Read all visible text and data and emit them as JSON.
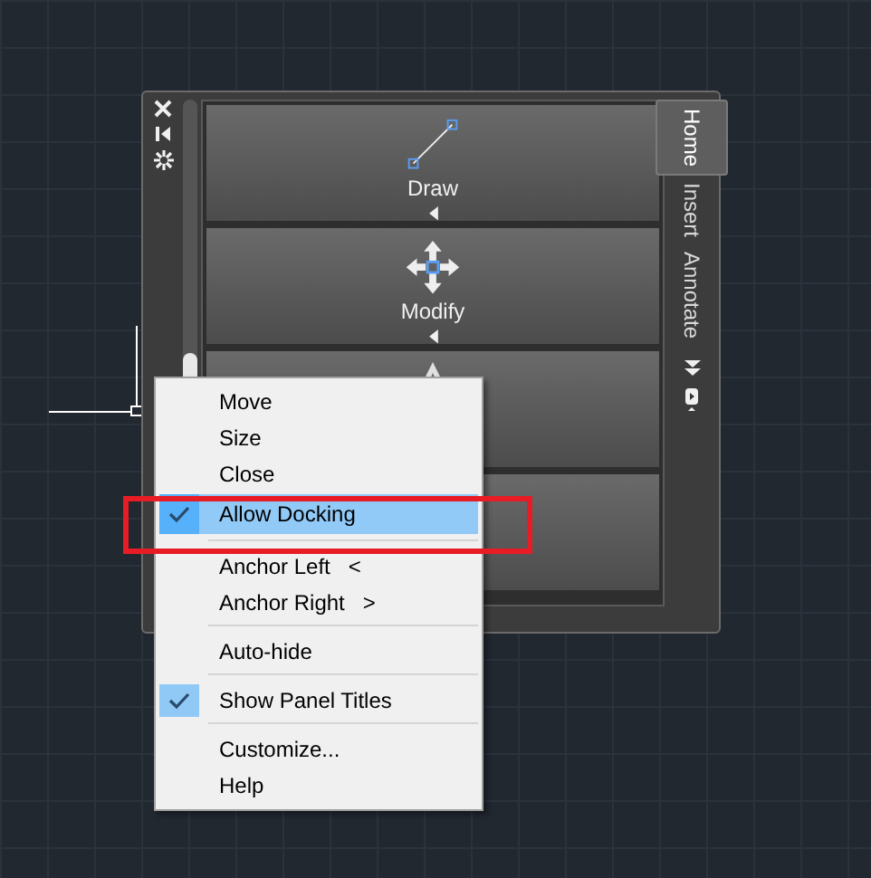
{
  "palette": {
    "panels": [
      {
        "kind": "draw",
        "label": "Draw"
      },
      {
        "kind": "modify",
        "label": "Modify"
      },
      {
        "kind": "annotation"
      },
      {
        "kind": "blank"
      }
    ],
    "tabs": [
      {
        "label": "Home",
        "selected": true
      },
      {
        "label": "Insert",
        "selected": false
      },
      {
        "label": "Annotate",
        "selected": false
      }
    ]
  },
  "context_menu": {
    "groups": [
      [
        {
          "label": "Move",
          "checked": false,
          "selected": false
        },
        {
          "label": "Size",
          "checked": false,
          "selected": false
        },
        {
          "label": "Close",
          "checked": false,
          "selected": false
        },
        {
          "label": "Allow Docking",
          "checked": true,
          "selected": true
        }
      ],
      [
        {
          "label": "Anchor Left",
          "hint": "<",
          "checked": false,
          "selected": false
        },
        {
          "label": "Anchor Right",
          "hint": ">",
          "checked": false,
          "selected": false
        }
      ],
      [
        {
          "label": "Auto-hide",
          "checked": false,
          "selected": false
        }
      ],
      [
        {
          "label": "Show Panel Titles",
          "checked": true,
          "selected": false
        }
      ],
      [
        {
          "label": "Customize...",
          "checked": false,
          "selected": false
        },
        {
          "label": "Help",
          "checked": false,
          "selected": false
        }
      ]
    ]
  }
}
